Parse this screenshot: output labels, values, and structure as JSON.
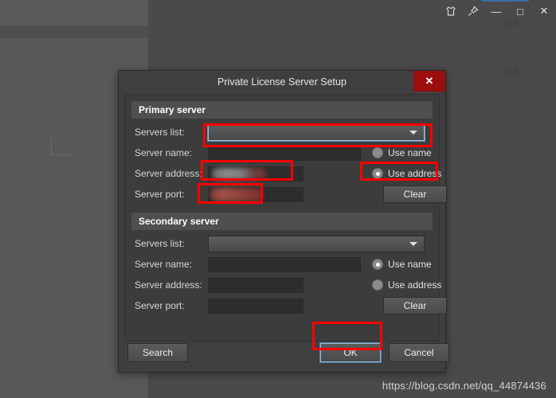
{
  "background": {
    "app_panels": {
      "left_toolbar": "left-toolbar-panel",
      "left_main": "left-main-panel",
      "canvas": "canvas-area"
    },
    "window_chrome": {
      "icons": [
        {
          "name": "garment-icon",
          "glyph": "\u0000"
        },
        {
          "name": "pin-icon",
          "glyph": "\u0000"
        }
      ],
      "minimize_label": "—",
      "maximize_label": "□",
      "close_label": "✕",
      "accent_color": "#3a6ea5"
    },
    "properties_panel": {
      "items": [
        {
          "label": "填充"
        },
        {
          "label": "线条"
        }
      ]
    }
  },
  "dialog": {
    "title": "Private License Server Setup",
    "close_label": "✕",
    "close_color": "#9c0d0d",
    "primary": {
      "group_title": "Primary server",
      "servers_list_label": "Servers list:",
      "servers_list_value": "",
      "server_name_label": "Server name:",
      "server_name_value": "",
      "server_address_label": "Server address:",
      "server_address_value": "",
      "server_port_label": "Server port:",
      "server_port_value": "",
      "use_name_label": "Use name",
      "use_address_label": "Use address",
      "selected_mode": "Use address",
      "clear_label": "Clear"
    },
    "secondary": {
      "group_title": "Secondary server",
      "servers_list_label": "Servers list:",
      "servers_list_value": "",
      "server_name_label": "Server name:",
      "server_name_value": "",
      "server_address_label": "Server address:",
      "server_address_value": "",
      "server_port_label": "Server port:",
      "server_port_value": "",
      "use_name_label": "Use name",
      "use_address_label": "Use address",
      "selected_mode": "Use name",
      "clear_label": "Clear"
    },
    "footer": {
      "search_label": "Search",
      "ok_label": "OK",
      "cancel_label": "Cancel"
    }
  },
  "annotations": {
    "color": "#ff0000",
    "boxes": [
      "servers-list-primary",
      "server-address-primary",
      "use-address-radio-primary",
      "server-port-primary",
      "ok-button"
    ]
  },
  "watermark": {
    "text": "https://blog.csdn.net/qq_44874436"
  }
}
